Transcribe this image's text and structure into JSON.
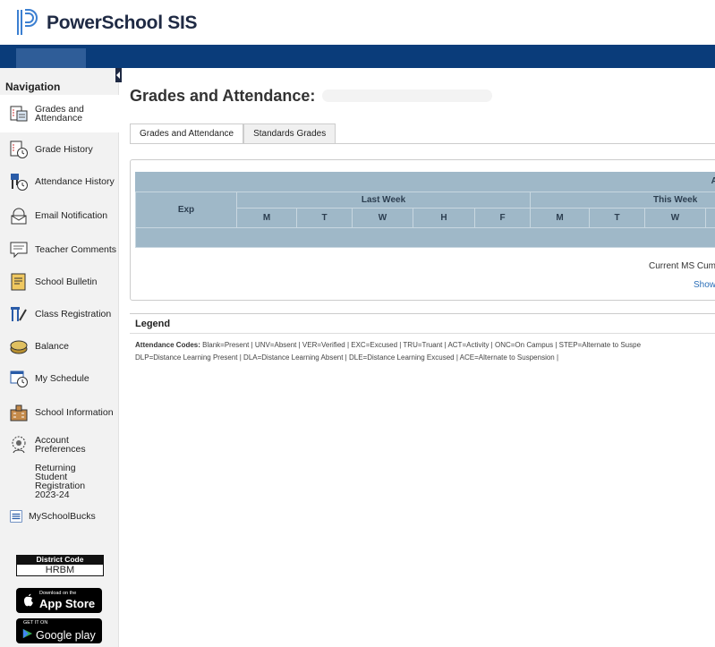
{
  "header": {
    "app_title": "PowerSchool SIS"
  },
  "nav": {
    "title": "Navigation",
    "items": [
      {
        "label": "Grades and Attendance",
        "icon": "grades-attendance-icon"
      },
      {
        "label": "Grade History",
        "icon": "grade-history-icon"
      },
      {
        "label": "Attendance History",
        "icon": "attendance-history-icon"
      },
      {
        "label": "Email Notification",
        "icon": "email-icon"
      },
      {
        "label": "Teacher Comments",
        "icon": "comments-icon"
      },
      {
        "label": "School Bulletin",
        "icon": "bulletin-icon"
      },
      {
        "label": "Class Registration",
        "icon": "registration-icon"
      },
      {
        "label": "Balance",
        "icon": "balance-icon"
      },
      {
        "label": "My Schedule",
        "icon": "schedule-icon"
      },
      {
        "label": "School Information",
        "icon": "school-icon"
      },
      {
        "label": "Account Preferences",
        "icon": "account-icon"
      },
      {
        "label": "Returning Student Registration 2023-24",
        "icon": ""
      },
      {
        "label": "MySchoolBucks",
        "icon": "myschoolbucks-icon"
      }
    ]
  },
  "district": {
    "title": "District Code",
    "code": "HRBM"
  },
  "stores": {
    "apple": {
      "small": "Download on the",
      "big": "App Store"
    },
    "google": {
      "small": "GET IT ON",
      "big": "Google play"
    }
  },
  "main": {
    "title": "Grades and Attendance:",
    "tabs": [
      "Grades and Attendance",
      "Standards Grades"
    ],
    "table": {
      "top_right": "Att",
      "exp": "Exp",
      "last_week": "Last Week",
      "this_week": "This Week",
      "days": [
        "M",
        "T",
        "W",
        "H",
        "F",
        "M",
        "T",
        "W"
      ]
    },
    "current_ms": "Current MS Cum",
    "show_link": "Show"
  },
  "legend": {
    "title": "Legend",
    "codes_label": "Attendance Codes:",
    "line1": "Blank=Present | UNV=Absent | VER=Verified | EXC=Excused | TRU=Truant | ACT=Activity | ONC=On Campus | STEP=Alternate to Suspe",
    "line2": "DLP=Distance Learning Present | DLA=Distance Learning Absent | DLE=Distance Learning Excused | ACE=Alternate to Suspension |"
  },
  "colors": {
    "header_bar": "#0a3c7a",
    "table_bg": "#9fb8c8",
    "link": "#2a6eb8"
  }
}
